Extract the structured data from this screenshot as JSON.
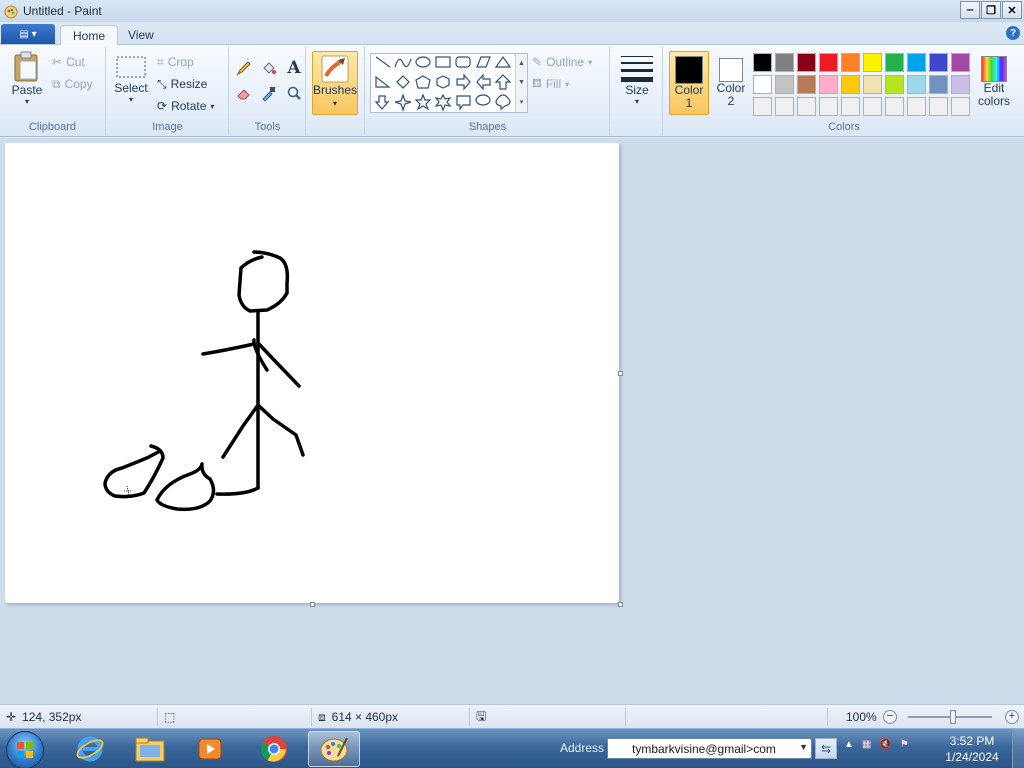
{
  "window": {
    "title": "Untitled - Paint",
    "controls": [
      "minimize",
      "restore",
      "close"
    ]
  },
  "tabs": [
    {
      "label": "Home",
      "active": true
    },
    {
      "label": "View",
      "active": false
    }
  ],
  "ribbon": {
    "clipboard": {
      "paste": "Paste",
      "cut": "Cut",
      "copy": "Copy",
      "label": "Clipboard"
    },
    "image": {
      "select": "Select",
      "crop": "Crop",
      "resize": "Resize",
      "rotate": "Rotate",
      "label": "Image"
    },
    "tools": {
      "label": "Tools",
      "items": [
        "pencil-icon",
        "fill-icon",
        "text-icon",
        "eraser-icon",
        "color-picker-icon",
        "magnifier-icon"
      ]
    },
    "brushes": {
      "label": "Brushes"
    },
    "shapes": {
      "outline": "Outline",
      "fill": "Fill",
      "label": "Shapes"
    },
    "size": {
      "label": "Size"
    },
    "colors": {
      "color1": {
        "label": "Color",
        "sub": "1",
        "value": "#000000"
      },
      "color2": {
        "label": "Color",
        "sub": "2",
        "value": "#ffffff"
      },
      "edit": {
        "label": "Edit",
        "sub": "colors"
      },
      "label": "Colors",
      "palette": [
        "#000000",
        "#7f7f7f",
        "#880015",
        "#ed1c24",
        "#ff7f27",
        "#fff200",
        "#22b14c",
        "#00a2e8",
        "#3f48cc",
        "#a349a4",
        "#ffffff",
        "#c3c3c3",
        "#b97a57",
        "#ffaec9",
        "#ffc90e",
        "#efe4b0",
        "#b5e61d",
        "#99d9ea",
        "#7092be",
        "#c8bfe7",
        "#f0f0f0",
        "#f0f0f0",
        "#f0f0f0",
        "#f0f0f0",
        "#f0f0f0",
        "#f0f0f0",
        "#f0f0f0",
        "#f0f0f0",
        "#f0f0f0",
        "#f0f0f0"
      ]
    }
  },
  "status": {
    "cursor_pos": "124, 352px",
    "selection_size": "",
    "canvas_size": "614 × 460px",
    "zoom": "100%"
  },
  "taskbar": {
    "address_label": "Address",
    "address_value": "tymbarkvisine@gmail>com",
    "time": "3:52 PM",
    "date": "1/24/2024"
  }
}
